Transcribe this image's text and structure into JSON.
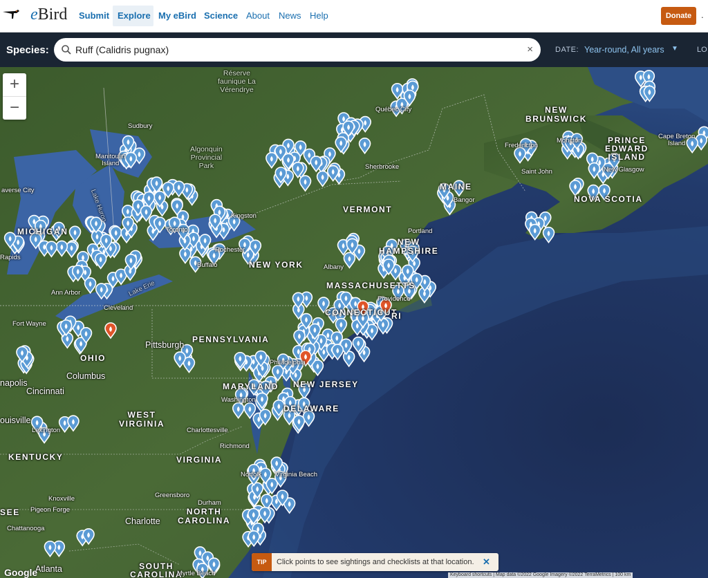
{
  "nav": {
    "brand": "Bird",
    "brand_e": "e",
    "items": [
      "Submit",
      "Explore",
      "My eBird",
      "Science",
      "About",
      "News",
      "Help"
    ],
    "donate": "Donate",
    "more": "."
  },
  "species_bar": {
    "label": "Species:",
    "search_value": "Ruff (Calidris pugnax)",
    "clear": "×",
    "date_label": "DATE:",
    "date_value": "Year-round,  All years",
    "date_caret": "▼",
    "loc_label": "LO"
  },
  "map": {
    "zoom_in": "+",
    "zoom_out": "−",
    "labels": {
      "reserve": "Réserve\nfaunique La\nVérendrye",
      "sudbury": "Sudbury",
      "algonquin": "Algonquin\nProvincial\nPark",
      "manitoulin": "Manitoulin\nIsland",
      "lake_huron": "Lake Huron",
      "traverse": "averse City",
      "michigan": "MICHIGAN",
      "toronto": "Toronto",
      "kingston": "Kingston",
      "rochester": "Rochester",
      "buffalo": "Buffalo",
      "new_york": "NEW YORK",
      "rapids": "Rapids",
      "quebec": "Québec City",
      "sherbrooke": "Sherbrooke",
      "vermont": "VERMONT",
      "maine": "MAINE",
      "bangor": "Bangor",
      "portland": "Portland",
      "new_hampshire": "NEW\nHAMPSHIRE",
      "albany": "Albany",
      "massachusetts": "MASSACHUSETTS",
      "connecticut": "CONNECTICUT",
      "ri": "RI",
      "providence": "Providence",
      "new_brunswick": "NEW\nBRUNSWICK",
      "moncton": "Moncton",
      "fredericton": "Fredericton",
      "saint_john": "Saint John",
      "pei": "PRINCE\nEDWARD\nISLAND",
      "cape_breton": "Cape Breton\nIsland",
      "new_glasgow": "New Glasgow",
      "nova_scotia": "NOVA SCOTIA",
      "ann_arbor": "Ann Arbor",
      "cleveland": "Cleveland",
      "lake_erie": "Lake Erie",
      "fort_wayne": "Fort Wayne",
      "pittsburgh": "Pittsburgh",
      "pennsylvania": "PENNSYLVANIA",
      "philadelphia": "Philadelphia",
      "new_jersey": "NEW JERSEY",
      "ohio": "OHIO",
      "columbus": "Columbus",
      "indianapolis": "napolis",
      "cincinnati": "Cincinnati",
      "maryland": "MARYLAND",
      "washington": "Washington",
      "delaware": "DELAWARE",
      "west_virginia": "WEST\nVIRGINIA",
      "louisville": "ouisville",
      "lexington": "Lexington",
      "charlottesville": "Charlottesville",
      "kentucky": "KENTUCKY",
      "virginia": "VIRGINIA",
      "richmond": "Richmond",
      "norfolk": "Norfolk",
      "virginia_beach": "Virginia Beach",
      "knoxville": "Knoxville",
      "pigeon_forge": "Pigeon Forge",
      "greensboro": "Greensboro",
      "durham": "Durham",
      "north_carolina": "NORTH\nCAROLINA",
      "charlotte": "Charlotte",
      "chattanooga": "Chattanooga",
      "atlanta": "Atlanta",
      "south_carolina": "SOUTH\nCAROLINA",
      "myrtle_beach": "Myrtle Beach",
      "see": "SEE"
    },
    "google": "Google",
    "attribution": "Keyboard shortcuts | Map data ©2022 Google Imagery ©2022 TerraMetrics | 100 km"
  },
  "tip": {
    "badge": "TIP",
    "text": "Click points to see sightings and checklists at that location.",
    "close": "✕"
  },
  "colors": {
    "accent": "#1a6faf",
    "donate": "#c65a11",
    "marker_blue": "#5b9bd5",
    "marker_red": "#e0552a"
  }
}
